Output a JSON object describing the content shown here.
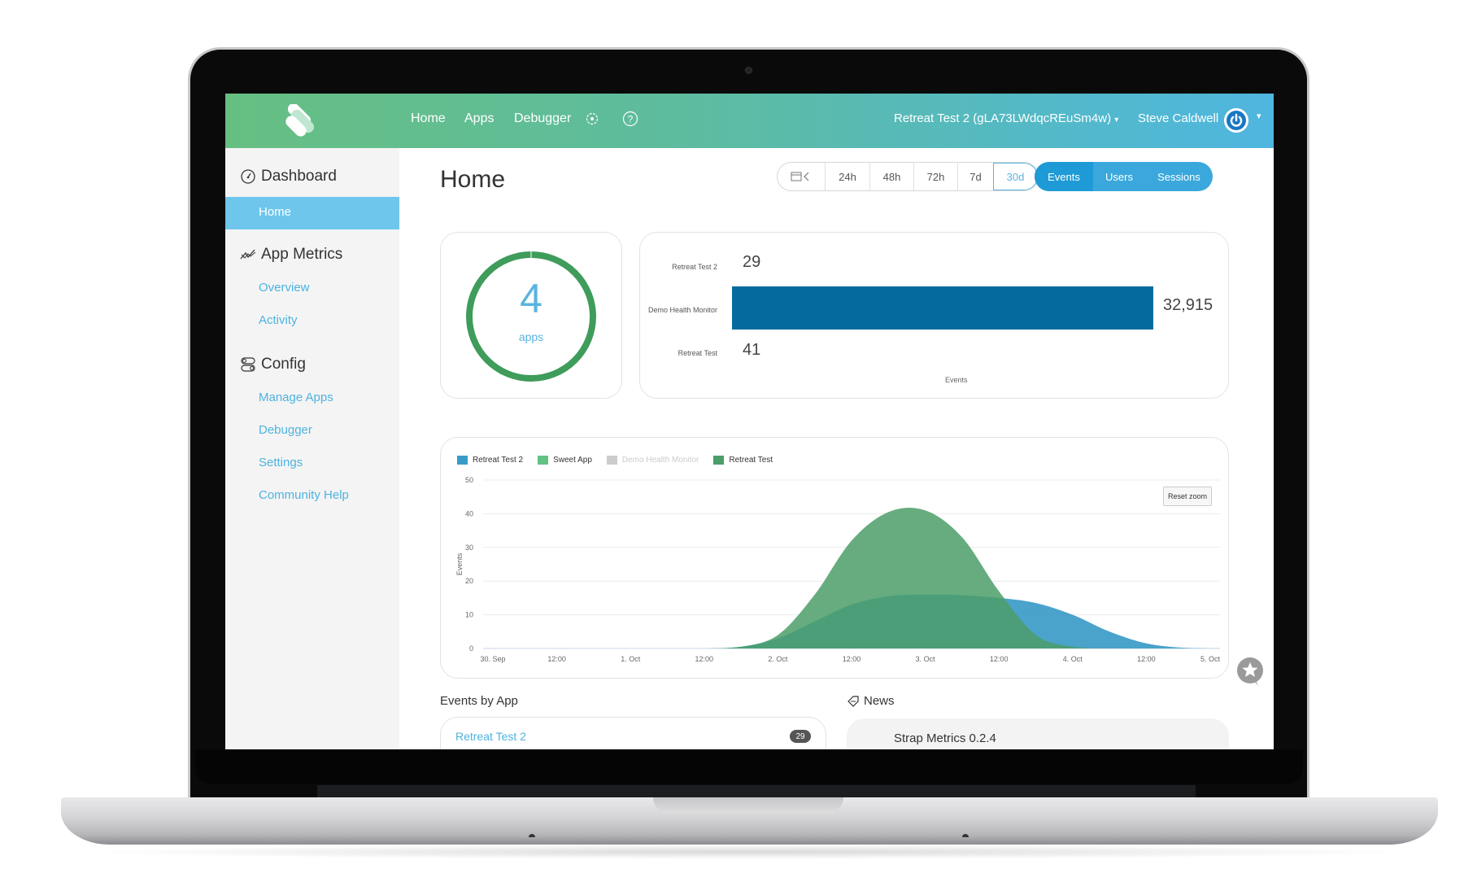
{
  "nav": {
    "links": [
      "Home",
      "Apps",
      "Debugger"
    ],
    "settings_icon": "gear-icon",
    "help_icon": "question-circle-icon",
    "app_selector": "Retreat Test 2 (gLA73LWdqcREuSm4w)",
    "user_name": "Steve Caldwell",
    "caret": "▾"
  },
  "sidebar": {
    "sections": [
      {
        "label": "Dashboard",
        "icon": "speedometer-icon",
        "items": [
          "Home"
        ],
        "active": "Home"
      },
      {
        "label": "App Metrics",
        "icon": "line-chart-icon",
        "items": [
          "Overview",
          "Activity"
        ]
      },
      {
        "label": "Config",
        "icon": "toggles-icon",
        "items": [
          "Manage Apps",
          "Debugger",
          "Settings",
          "Community Help"
        ]
      }
    ]
  },
  "main": {
    "title": "Home",
    "range_buttons": [
      "24h",
      "48h",
      "72h",
      "7d",
      "30d"
    ],
    "range_active": "30d",
    "metric_buttons": [
      "Events",
      "Users",
      "Sessions"
    ],
    "metric_active": "Events"
  },
  "summary": {
    "app_count": "4",
    "app_label": "apps",
    "ring_color": "#3f9c5b"
  },
  "bar_chart": {
    "type": "bar",
    "orientation": "horizontal",
    "categories": [
      "Retreat Test 2",
      "Demo Health Monitor",
      "Retreat Test"
    ],
    "values": [
      29,
      32915,
      41
    ],
    "value_labels": [
      "29",
      "32,915",
      "41"
    ],
    "xlabel": "Events",
    "color": "#056b9e"
  },
  "chart_data": {
    "type": "area",
    "title": "",
    "ylabel": "Events",
    "xlabel": "",
    "ylim": [
      0,
      50
    ],
    "yticks": [
      0,
      10,
      20,
      30,
      40,
      50
    ],
    "xticks": [
      "30. Sep",
      "12:00",
      "1. Oct",
      "12:00",
      "2. Oct",
      "12:00",
      "3. Oct",
      "12:00",
      "4. Oct",
      "12:00",
      "5. Oct"
    ],
    "x_hours": [
      0,
      6,
      12,
      18,
      24,
      30,
      36,
      42,
      48,
      54,
      60,
      66,
      72,
      78,
      84,
      90,
      96,
      102,
      108,
      114,
      120
    ],
    "grid": true,
    "legend_position": "top-left",
    "reset_zoom_label": "Reset zoom",
    "series": [
      {
        "name": "Retreat Test 2",
        "color": "#3a9bc7",
        "visible": true,
        "values": [
          0,
          0,
          0,
          0,
          0,
          0,
          0,
          0.5,
          3,
          8,
          13,
          15.5,
          16,
          15.8,
          15,
          13.5,
          10,
          5,
          1.5,
          0.2,
          0
        ]
      },
      {
        "name": "Sweet App",
        "color": "#62c284",
        "visible": true,
        "values": [
          0,
          0,
          0,
          0,
          0,
          0,
          0,
          0,
          0,
          0,
          0,
          0,
          0,
          0,
          0,
          0,
          0,
          0,
          0,
          0,
          0
        ]
      },
      {
        "name": "Demo Health Monitor",
        "color": "#cccccc",
        "visible": false,
        "values": []
      },
      {
        "name": "Retreat Test",
        "color": "#4b9e68",
        "visible": true,
        "values": [
          0,
          0,
          0,
          0,
          0,
          0,
          0,
          0.5,
          4,
          16,
          32,
          40.5,
          41,
          33,
          17,
          4,
          0.5,
          0,
          0,
          0,
          0
        ]
      }
    ]
  },
  "events_by_app": {
    "title": "Events by App",
    "items": [
      {
        "name": "Retreat Test 2",
        "count": "29"
      }
    ]
  },
  "news": {
    "title": "News",
    "icon": "tag-icon",
    "items": [
      "Strap Metrics 0.2.4"
    ]
  }
}
